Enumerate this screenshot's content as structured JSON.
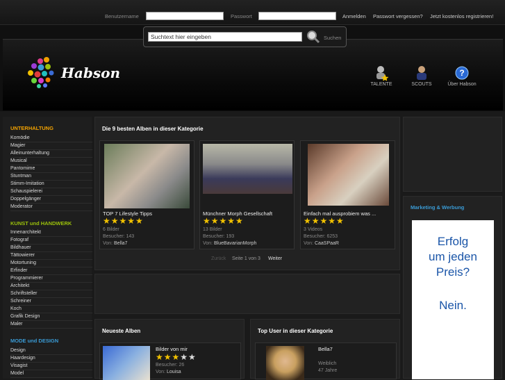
{
  "topbar": {
    "username_label": "Benutzername",
    "password_label": "Passwort",
    "login": "Anmelden",
    "forgot": "Passwort vergessen?",
    "register": "Jetzt kostenlos registrieren!"
  },
  "search": {
    "placeholder": "Suchtext hier eingeben",
    "button": "Suchen"
  },
  "logo": {
    "text": "Habson"
  },
  "nav": [
    {
      "label": "TALENTE",
      "icon": "star-user-icon"
    },
    {
      "label": "SCOUTS",
      "icon": "user-icon"
    },
    {
      "label": "Über Habson",
      "icon": "help-icon"
    }
  ],
  "sidebar": {
    "sections": [
      {
        "title": "UNTERHALTUNG",
        "items": [
          "Komödie",
          "Magier",
          "Alleinunterhaltung",
          "Musical",
          "Pantomime",
          "Stuntman",
          "Stimm-Imitation",
          "Schauspielerei",
          "Doppelgänger",
          "Moderator"
        ]
      },
      {
        "title": "KUNST und HANDWERK",
        "items": [
          "Innenarchitekt",
          "Fotograf",
          "Bildhauer",
          "Tättowierer",
          "Motortuning",
          "Erfinder",
          "Programmierer",
          "Architekt",
          "Schriftsteller",
          "Schreiner",
          "Koch",
          "Grafik Design",
          "Maler"
        ]
      },
      {
        "title": "MODE und DESIGN",
        "items": [
          "Design",
          "Haardesign",
          "Visagist",
          "Model"
        ]
      }
    ]
  },
  "albums": {
    "title": "Die 9 besten Alben in dieser Kategorie",
    "cards": [
      {
        "title": "TOP 7 Lifestyle Tipps",
        "rating": 5,
        "count": "6 Bilder",
        "visitors": "Besucher: 143",
        "from_label": "Von:",
        "from": "Bella7"
      },
      {
        "title": "Münchner Morph Gesellschaft",
        "rating": 5,
        "count": "13 Bilder",
        "visitors": "Besucher: 193",
        "from_label": "Von:",
        "from": "BlueBavarianMorph"
      },
      {
        "title": "Einfach mal ausprobiem was ...",
        "rating": 5,
        "count": "3 Videos",
        "visitors": "Besucher: 6253",
        "from_label": "Von:",
        "from": "CaaSPaaR"
      }
    ],
    "pager": {
      "back": "Zurück",
      "page": "Seite 1 von 3",
      "next": "Weiter"
    }
  },
  "newest": {
    "title": "Neueste Alben",
    "card": {
      "title": "Bilder von mir",
      "rating": 3,
      "visitors": "Besucher: 26",
      "from_label": "Von:",
      "from": "Louisa"
    }
  },
  "topuser": {
    "title": "Top User in dieser Kategorie",
    "name": "Bella7",
    "gender": "Weiblich",
    "age": "47 Jahre"
  },
  "ad": {
    "title": "Marketing & Werbung",
    "line1": "Erfolg",
    "line2": "um jeden",
    "line3": "Preis?",
    "line4": "Nein."
  },
  "colors": {
    "accent_orange": "#f2a100",
    "accent_green": "#9bc10b",
    "accent_blue": "#3a9bd5",
    "star": "#f2c200"
  }
}
